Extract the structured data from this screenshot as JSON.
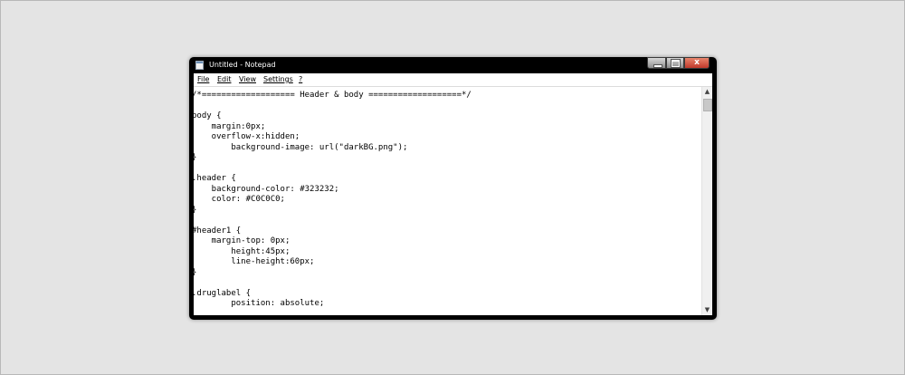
{
  "window": {
    "title": "Untitled - Notepad",
    "icon": "notepad-icon",
    "controls": {
      "minimize": "minimize-icon",
      "maximize": "maximize-icon",
      "close_label": "x"
    }
  },
  "menu": [
    {
      "label": "File"
    },
    {
      "label": "Edit"
    },
    {
      "label": "View"
    },
    {
      "label": "Settings"
    },
    {
      "label": "?"
    }
  ],
  "editor": {
    "lines": [
      "/*=================== Header & body ===================*/",
      "",
      "body {",
      "    margin:0px;",
      "    overflow-x:hidden;",
      "        background-image: url(\"darkBG.png\");",
      "}",
      "",
      ".header {",
      "    background-color: #323232;",
      "    color: #C0C0C0;",
      "}",
      "",
      "#header1 {",
      "    margin-top: 0px;",
      "        height:45px;",
      "        line-height:60px;",
      "}",
      "",
      ".druglabel {",
      "        position: absolute;"
    ]
  },
  "scrollbar": {
    "up_arrow": "chevron-up-icon",
    "down_arrow": "chevron-down-icon",
    "position": 0.0
  },
  "colors": {
    "background": "#e4e4e4",
    "window_frame": "#000000",
    "close_button": "#c0392b",
    "editor_bg": "#ffffff"
  }
}
